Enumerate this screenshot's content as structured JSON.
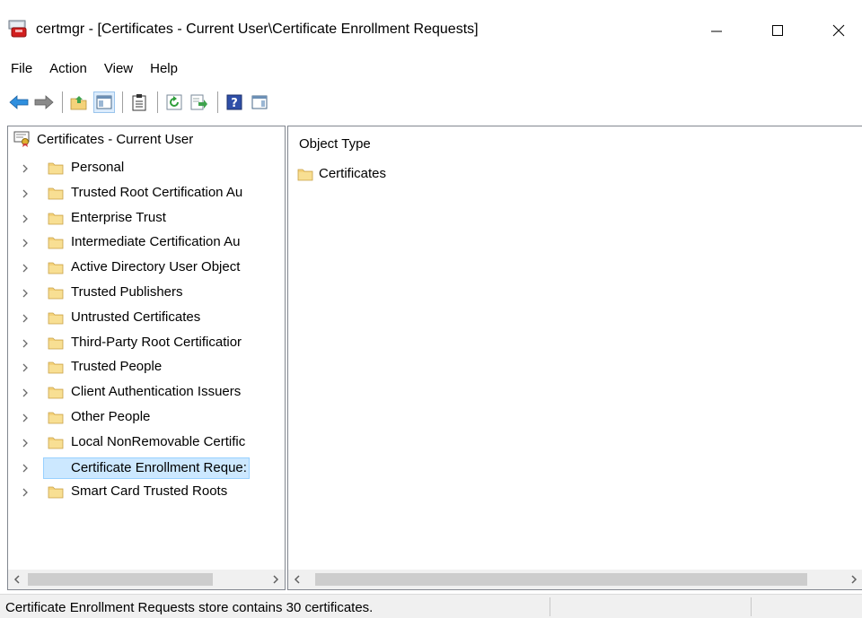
{
  "window": {
    "title": "certmgr - [Certificates - Current User\\Certificate Enrollment Requests]",
    "minimize_glyph": "—",
    "maximize_glyph": "☐",
    "close_glyph": "✕"
  },
  "menu": [
    "File",
    "Action",
    "View",
    "Help"
  ],
  "toolbar": {
    "buttons": [
      "back-arrow-icon",
      "forward-arrow-icon",
      "up-folder-icon",
      "show-hide-console-tree-icon",
      "properties-clipboard-icon",
      "refresh-icon",
      "export-list-icon",
      "help-icon",
      "show-hide-action-pane-icon"
    ]
  },
  "tree": {
    "root": "Certificates - Current User",
    "items": [
      {
        "label": "Personal",
        "selected": false
      },
      {
        "label": "Trusted Root Certification Au",
        "selected": false
      },
      {
        "label": "Enterprise Trust",
        "selected": false
      },
      {
        "label": "Intermediate Certification Au",
        "selected": false
      },
      {
        "label": "Active Directory User Object",
        "selected": false
      },
      {
        "label": "Trusted Publishers",
        "selected": false
      },
      {
        "label": "Untrusted Certificates",
        "selected": false
      },
      {
        "label": "Third-Party Root Certificatior",
        "selected": false
      },
      {
        "label": "Trusted People",
        "selected": false
      },
      {
        "label": "Client Authentication Issuers",
        "selected": false
      },
      {
        "label": "Other People",
        "selected": false
      },
      {
        "label": "Local NonRemovable Certific",
        "selected": false
      },
      {
        "label": "Certificate Enrollment Reque:",
        "selected": true
      },
      {
        "label": "Smart Card Trusted Roots",
        "selected": false
      }
    ]
  },
  "details": {
    "column_header": "Object Type",
    "rows": [
      "Certificates"
    ]
  },
  "status": {
    "text": "Certificate Enrollment Requests store contains 30 certificates."
  },
  "colors": {
    "selection_bg": "#cce8ff",
    "selection_border": "#99d1ff",
    "folder": "#f4d27a",
    "back_arrow": "#2f8fde"
  }
}
